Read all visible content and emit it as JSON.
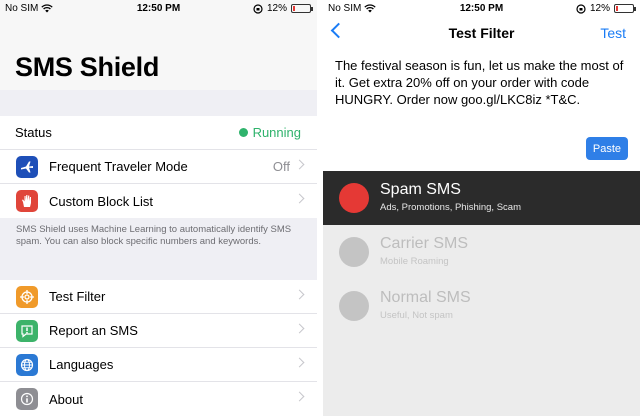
{
  "status_bar": {
    "carrier": "No SIM",
    "time": "12:50 PM",
    "battery_percent": "12%",
    "battery_level": 0.12,
    "battery_color": "#e53935"
  },
  "left": {
    "app_title": "SMS Shield",
    "status": {
      "label": "Status",
      "value": "Running",
      "color": "#2fb36c"
    },
    "settings": [
      {
        "label": "Frequent Traveler Mode",
        "value": "Off",
        "icon": "airplane-icon",
        "icon_color": "#1e4fb8"
      },
      {
        "label": "Custom Block List",
        "value": "",
        "icon": "hand-icon",
        "icon_color": "#e0453a"
      }
    ],
    "footnote": "SMS Shield uses Machine Learning to automatically identify SMS spam. You can also block specific numbers and keywords.",
    "menu": [
      {
        "label": "Test Filter",
        "icon": "target-icon",
        "icon_color": "#f09a2a"
      },
      {
        "label": "Report an SMS",
        "icon": "exclamation-icon",
        "icon_color": "#3db36a"
      },
      {
        "label": "Languages",
        "icon": "globe-icon",
        "icon_color": "#2b79d4"
      },
      {
        "label": "About",
        "icon": "info-icon",
        "icon_color": "#8e8e93"
      }
    ]
  },
  "right": {
    "nav": {
      "title": "Test Filter",
      "action": "Test"
    },
    "message": "The festival season is fun, let us make the most of it. Get extra 20% off on your order with code HUNGRY. Order now goo.gl/LKC8iz *T&C.",
    "paste_label": "Paste",
    "options": [
      {
        "title": "Spam SMS",
        "subtitle": "Ads, Promotions, Phishing, Scam",
        "selected": true,
        "color": "#e53935"
      },
      {
        "title": "Carrier SMS",
        "subtitle": "Mobile Roaming",
        "selected": false,
        "color": "#c4c4c4"
      },
      {
        "title": "Normal SMS",
        "subtitle": "Useful, Not spam",
        "selected": false,
        "color": "#c4c4c4"
      }
    ]
  }
}
